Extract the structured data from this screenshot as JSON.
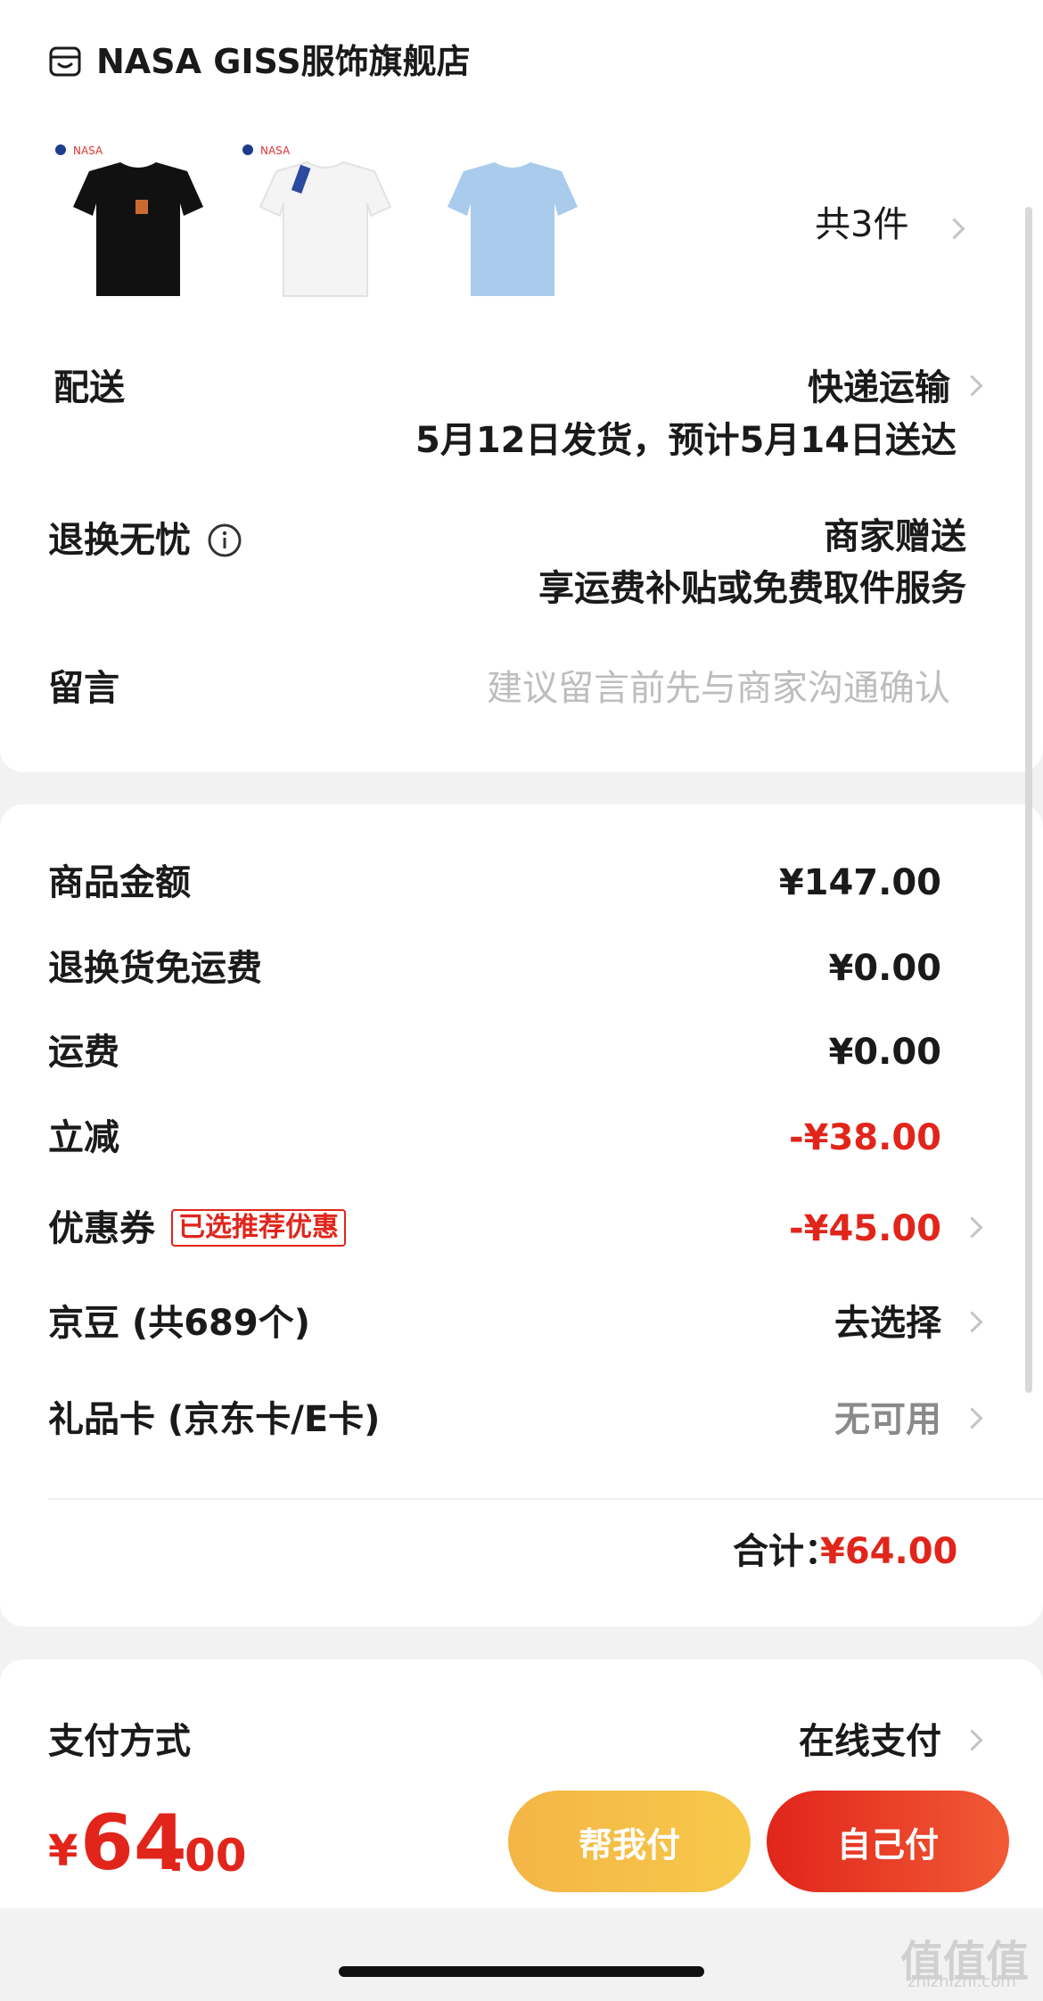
{
  "shop": {
    "name": "NASA GISS服饰旗舰店",
    "icon": "shop-icon"
  },
  "products": {
    "brand_tag": "NASA",
    "items": [
      {
        "color_name": "black",
        "color": "#111111"
      },
      {
        "color_name": "white",
        "color": "#f4f4f4"
      },
      {
        "color_name": "light-blue",
        "color": "#a9cbec"
      }
    ],
    "count_label": "共3件"
  },
  "delivery": {
    "label": "配送",
    "method": "快递运输",
    "schedule": "5月12日发货，预计5月14日送达"
  },
  "returns": {
    "label": "退换无忧",
    "info_icon": "info-icon",
    "value": "商家赠送",
    "detail": "享运费补贴或免费取件服务"
  },
  "message": {
    "label": "留言",
    "placeholder": "建议留言前先与商家沟通确认"
  },
  "summary": {
    "goods_amount_label": "商品金额",
    "goods_amount": "¥147.00",
    "return_free_shipping_label": "退换货免运费",
    "return_free_shipping": "¥0.00",
    "shipping_label": "运费",
    "shipping": "¥0.00",
    "instant_discount_label": "立减",
    "instant_discount": "-¥38.00",
    "coupon_label": "优惠券",
    "coupon_badge": "已选推荐优惠",
    "coupon_value": "-¥45.00",
    "jingdou_label": "京豆 (共689个)",
    "jingdou_value": "去选择",
    "giftcard_label": "礼品卡 (京东卡/E卡)",
    "giftcard_value": "无可用",
    "total_label": "合计：",
    "total_value": "¥64.00"
  },
  "payment": {
    "label": "支付方式",
    "value": "在线支付"
  },
  "bottom": {
    "currency": "¥",
    "price_int": "64",
    "price_dec": ".00",
    "help_pay_label": "帮我付",
    "self_pay_label": "自己付"
  },
  "colors": {
    "accent_red": "#e1251b",
    "help_pay_gradient": [
      "#f4b545",
      "#f7c94a"
    ],
    "self_pay_gradient": [
      "#e1251b",
      "#f15a35"
    ]
  },
  "watermark": {
    "main": "值值值",
    "sub": "zhizhizhi.com"
  }
}
